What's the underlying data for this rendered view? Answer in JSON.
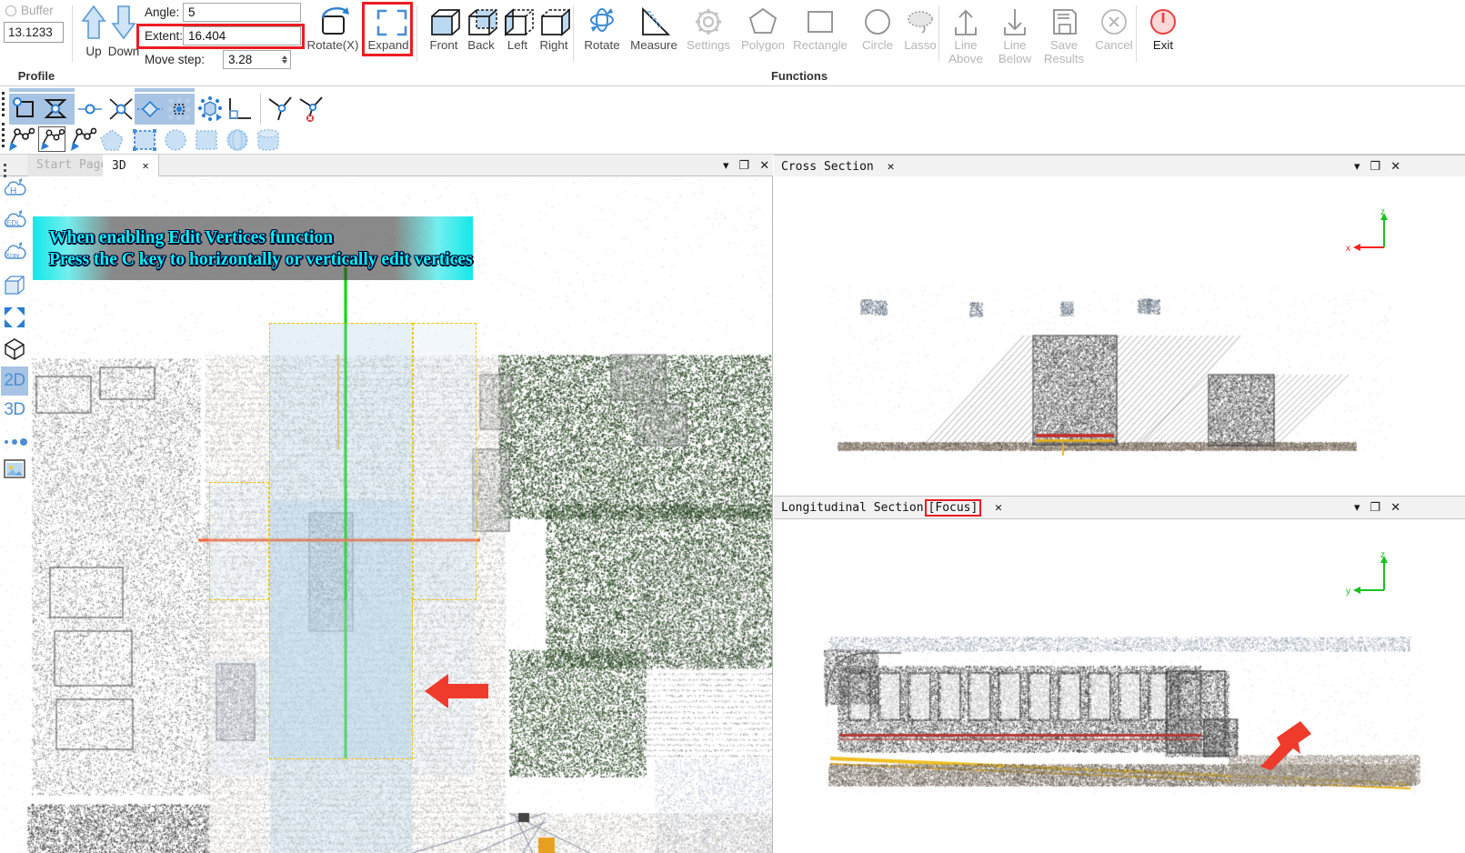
{
  "ribbon": {
    "profile_group": {
      "group_label": "Profile",
      "buffer_label": "Buffer",
      "buffer_checked": false,
      "buffer_value": "13.1233"
    },
    "move_buttons": [
      {
        "name": "up",
        "label": "Up",
        "icon": "arrow-up-icon"
      },
      {
        "name": "down",
        "label": "Down",
        "icon": "arrow-down-icon"
      }
    ],
    "fields": [
      {
        "name": "angle",
        "label": "Angle:",
        "value": "5",
        "spinner": false
      },
      {
        "name": "extent",
        "label": "Extent:",
        "value": "16.404",
        "spinner": false,
        "highlighted": true
      },
      {
        "name": "move-step",
        "label": "Move step:",
        "value": "3.28",
        "spinner": true
      }
    ],
    "rotate_x": {
      "label": "Rotate(X)",
      "icon": "rotate-x-icon"
    },
    "expand": {
      "label": "Expand",
      "icon": "expand-icon",
      "highlighted": true
    },
    "functions_group_label": "Functions",
    "functions": [
      {
        "name": "front",
        "label": "Front",
        "icon": "cube-front-icon",
        "enabled": true
      },
      {
        "name": "back",
        "label": "Back",
        "icon": "cube-back-icon",
        "enabled": true
      },
      {
        "name": "left",
        "label": "Left",
        "icon": "cube-left-icon",
        "enabled": true
      },
      {
        "name": "right",
        "label": "Right",
        "icon": "cube-right-icon",
        "enabled": true
      },
      {
        "name": "rotate",
        "label": "Rotate",
        "icon": "rotate-icon",
        "enabled": true
      },
      {
        "name": "measure",
        "label": "Measure",
        "icon": "measure-icon",
        "enabled": true
      },
      {
        "name": "settings",
        "label": "Settings",
        "icon": "gear-icon",
        "enabled": false
      },
      {
        "name": "polygon",
        "label": "Polygon",
        "icon": "polygon-icon",
        "enabled": false
      },
      {
        "name": "rectangle",
        "label": "Rectangle",
        "icon": "rectangle-icon",
        "enabled": false
      },
      {
        "name": "circle",
        "label": "Circle",
        "icon": "circle-icon",
        "enabled": false
      },
      {
        "name": "lasso",
        "label": "Lasso",
        "icon": "lasso-icon",
        "enabled": false
      },
      {
        "name": "line-above",
        "label": "Line\nAbove",
        "icon": "arrow-up-line-icon",
        "enabled": false
      },
      {
        "name": "line-below",
        "label": "Line\nBelow",
        "icon": "arrow-down-line-icon",
        "enabled": false
      },
      {
        "name": "save-results",
        "label": "Save\nResults",
        "icon": "save-icon",
        "enabled": false
      },
      {
        "name": "cancel",
        "label": "Cancel",
        "icon": "cancel-circle-icon",
        "enabled": false
      },
      {
        "name": "exit",
        "label": "Exit",
        "icon": "power-icon",
        "enabled": true
      }
    ]
  },
  "toolbar2": {
    "row1": [
      {
        "name": "edit-vertices-rect",
        "icon": "vertex-rect-icon",
        "active": true
      },
      {
        "name": "edit-vertices-bowtie",
        "icon": "vertex-bowtie-icon",
        "active": true
      },
      {
        "name": "segment-node",
        "icon": "segment-node-icon",
        "active": false
      },
      {
        "name": "cross-node",
        "icon": "cross-node-icon",
        "active": false
      },
      {
        "name": "move-vertex",
        "icon": "move-vertex-icon",
        "active": true
      },
      {
        "name": "select-points",
        "icon": "select-points-icon",
        "active": true
      },
      {
        "name": "sphere-select",
        "icon": "sphere-select-icon",
        "active": false
      },
      {
        "name": "corner-snap",
        "icon": "corner-snap-icon",
        "active": false
      },
      {
        "name": "add-vertex",
        "icon": "add-vertex-icon",
        "active": false
      },
      {
        "name": "delete-vertex",
        "icon": "delete-vertex-icon",
        "active": false
      }
    ],
    "row2": [
      {
        "name": "polyline-edit",
        "icon": "polyline-edit-icon",
        "active": false
      },
      {
        "name": "polyline-edit-boxed",
        "icon": "polyline-edit-box-icon",
        "active": false,
        "boxed": true
      },
      {
        "name": "polyline-cut",
        "icon": "polyline-cut-icon",
        "active": false
      },
      {
        "name": "shape-polygon",
        "icon": "shape-polygon-icon",
        "active": false
      },
      {
        "name": "shape-square-dashed",
        "icon": "shape-square-dashed-icon",
        "active": false
      },
      {
        "name": "shape-circle",
        "icon": "shape-circle-icon",
        "active": false
      },
      {
        "name": "shape-square",
        "icon": "shape-square-icon",
        "active": false
      },
      {
        "name": "shape-sphere",
        "icon": "shape-sphere-icon",
        "active": false
      },
      {
        "name": "shape-cylinder",
        "icon": "shape-cylinder-icon",
        "active": false
      }
    ]
  },
  "tabs": [
    {
      "name": "start-page",
      "label": "Start Page",
      "active": false,
      "closable": false
    },
    {
      "name": "3d",
      "label": "3D",
      "active": true,
      "closable": true
    }
  ],
  "sidebar": {
    "items": [
      {
        "name": "height-colour",
        "label": "H",
        "icon": "cloud-h-icon",
        "selected": false
      },
      {
        "name": "edl-shading",
        "label": "EDL",
        "icon": "cloud-edl-icon",
        "selected": false
      },
      {
        "name": "xray-view",
        "label": "Xray",
        "icon": "cloud-xray-icon",
        "selected": false
      },
      {
        "name": "bounding-box",
        "label": "",
        "icon": "box-icon",
        "selected": false
      },
      {
        "name": "fit-view",
        "label": "",
        "icon": "fit-arrows-icon",
        "selected": false
      },
      {
        "name": "perspective",
        "label": "",
        "icon": "cube-3d-icon",
        "selected": false
      },
      {
        "name": "view-2d",
        "label": "2D",
        "icon": "text-icon",
        "selected": true
      },
      {
        "name": "view-3d",
        "label": "3D",
        "icon": "text-icon",
        "selected": false
      },
      {
        "name": "point-size",
        "label": "",
        "icon": "dots-icon",
        "selected": false
      },
      {
        "name": "screenshot",
        "label": "",
        "icon": "image-icon",
        "selected": false
      }
    ]
  },
  "viewport_3d": {
    "name": "3d-viewport",
    "annotation": "When enabling Edit Vertices function\nPress the C key to horizontally or vertically edit vertices",
    "window_controls": [
      {
        "name": "dropdown",
        "glyph": "▾"
      },
      {
        "name": "restore",
        "glyph": "❐"
      },
      {
        "name": "close",
        "glyph": "✕"
      }
    ]
  },
  "cross_section": {
    "name": "cross-section-panel",
    "title": "Cross Section",
    "close_glyph": "✕",
    "axes": {
      "vertical": "z",
      "horizontal": "x"
    },
    "window_controls": [
      {
        "name": "dropdown",
        "glyph": "▾"
      },
      {
        "name": "restore",
        "glyph": "❐"
      },
      {
        "name": "close",
        "glyph": "✕"
      }
    ]
  },
  "longitudinal_section": {
    "name": "longitudinal-section-panel",
    "title": "Longitudinal Section",
    "focus_tag": "[Focus]",
    "close_glyph": "✕",
    "axes": {
      "vertical": "z",
      "horizontal": "y"
    },
    "window_controls": [
      {
        "name": "dropdown",
        "glyph": "▾"
      },
      {
        "name": "restore",
        "glyph": "❐"
      },
      {
        "name": "close",
        "glyph": "✕"
      }
    ]
  },
  "colors": {
    "accent_blue": "#4d8ed4",
    "highlight_red": "#ed1c24",
    "selection_yellow": "#f5c400",
    "annotation_cyan": "#00f5f5",
    "toolbar_highlight": "#a8c4e4",
    "profile_line_green": "#00d000",
    "profile_line_orange": "#ff6a33",
    "axis_z": "#00b000",
    "axis_x": "#ff2020",
    "pointer_arrow": "#f03020"
  }
}
